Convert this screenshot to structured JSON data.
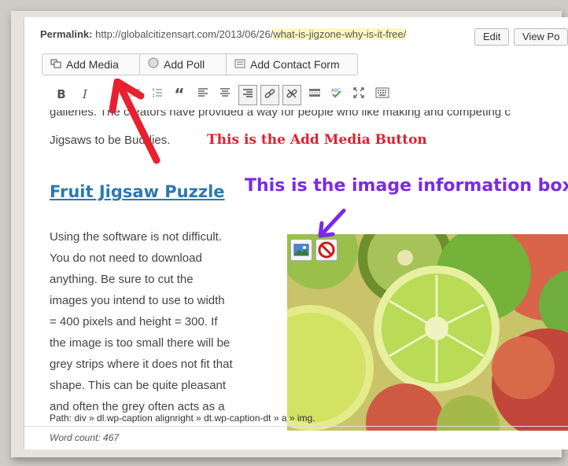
{
  "editor": {
    "permalink_label": "Permalink:",
    "permalink_url_base": "http://globalcitizensart.com/2013/06/26/",
    "permalink_slug": "what-is-jigzone-why-is-it-free/",
    "edit_button": "Edit",
    "view_button": "View Po"
  },
  "media_buttons": [
    {
      "label": "Add Media",
      "icon": "media-icon"
    },
    {
      "label": "Add Poll",
      "icon": "poll-icon"
    },
    {
      "label": "Add Contact Form",
      "icon": "form-icon"
    }
  ],
  "toolbar": {
    "bold": "B",
    "italic": "I",
    "quote": "“"
  },
  "content": {
    "line1": "galleries. The creators have provided a way for people who like making and competing c",
    "line2": "Jigsaws to be Buddies.",
    "heading": "Fruit Jigsaw Puzzle",
    "body_lines": [
      "Using the software is not difficult.",
      "You do not need to download",
      "anything.  Be sure to cut the",
      "images you intend to use to width",
      "= 400 pixels and height = 300.  If",
      "the image is too small there will be",
      "grey strips where it does not fit that",
      "shape.  This can be quite pleasant",
      "and often the grey often acts as a"
    ]
  },
  "annotations": {
    "add_media": "This is the Add Media Button",
    "image_info": "This is the image information box",
    "red_color": "#e02030",
    "purple_color": "#7a2ae6"
  },
  "status": {
    "path": "Path: div » dl.wp-caption alignright » dt.wp-caption-dt » a » img.",
    "word_count": "Word count: 467"
  },
  "colors": {
    "link": "#2a7ab0"
  }
}
